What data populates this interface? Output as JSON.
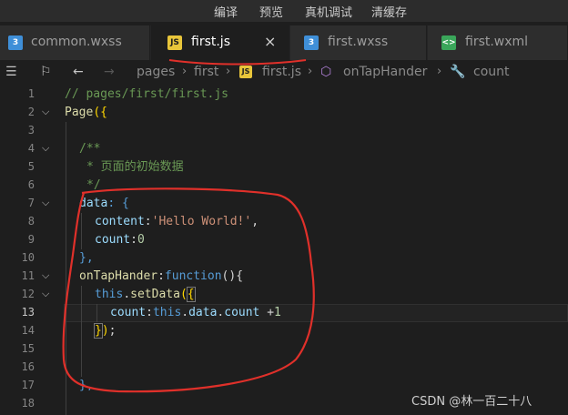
{
  "menubar": {
    "items": [
      "编译",
      "预览",
      "真机调试",
      "清缓存"
    ]
  },
  "tabs": [
    {
      "label": "common.wxss",
      "icon": "css-file-icon",
      "active": false
    },
    {
      "label": "first.js",
      "icon": "js-file-icon",
      "active": true
    },
    {
      "label": "first.wxss",
      "icon": "css-file-icon",
      "active": false
    },
    {
      "label": "first.wxml",
      "icon": "wxml-file-icon",
      "active": false
    }
  ],
  "tab_close_glyph": "×",
  "breadcrumb": {
    "items": [
      "pages",
      "first",
      "first.js",
      "onTapHander",
      "count"
    ]
  },
  "editor": {
    "line_numbers": [
      "1",
      "2",
      "3",
      "4",
      "5",
      "6",
      "7",
      "8",
      "9",
      "10",
      "11",
      "12",
      "13",
      "14",
      "15",
      "16",
      "17",
      "18"
    ],
    "current_line": "13",
    "lines": {
      "l1": "// pages/first/first.js",
      "l2_a": "Page",
      "l2_b": "({",
      "l4": "/**",
      "l5_star": "* ",
      "l5_text": "页面的初始数据",
      "l6": "*/",
      "l7_a": "data",
      "l7_b": ": {",
      "l8_a": "content",
      "l8_b": ":",
      "l8_c": "'Hello World!'",
      "l8_d": ",",
      "l9_a": "count",
      "l9_b": ":",
      "l9_c": "0",
      "l10": "},",
      "l11_a": "onTapHander",
      "l11_b": ":",
      "l11_c": "function",
      "l11_d": "(){",
      "l12_a": "this",
      "l12_b": ".",
      "l12_c": "setData",
      "l12_d": "(",
      "l12_e": "{",
      "l13_a": "count",
      "l13_b": ":",
      "l13_c": "this",
      "l13_d": ".",
      "l13_e": "data",
      "l13_f": ".",
      "l13_g": "count",
      "l13_h": " +",
      "l13_i": "1",
      "l14_a": "}",
      "l14_b": ")",
      "l14_c": ";",
      "l17": "},"
    }
  },
  "watermark": "CSDN @林一百二十八",
  "colors": {
    "annotation": "#e0302a",
    "js_badge": "#e8c53a",
    "css_badge": "#3f8fd8",
    "wxml_badge": "#3aa65a"
  }
}
